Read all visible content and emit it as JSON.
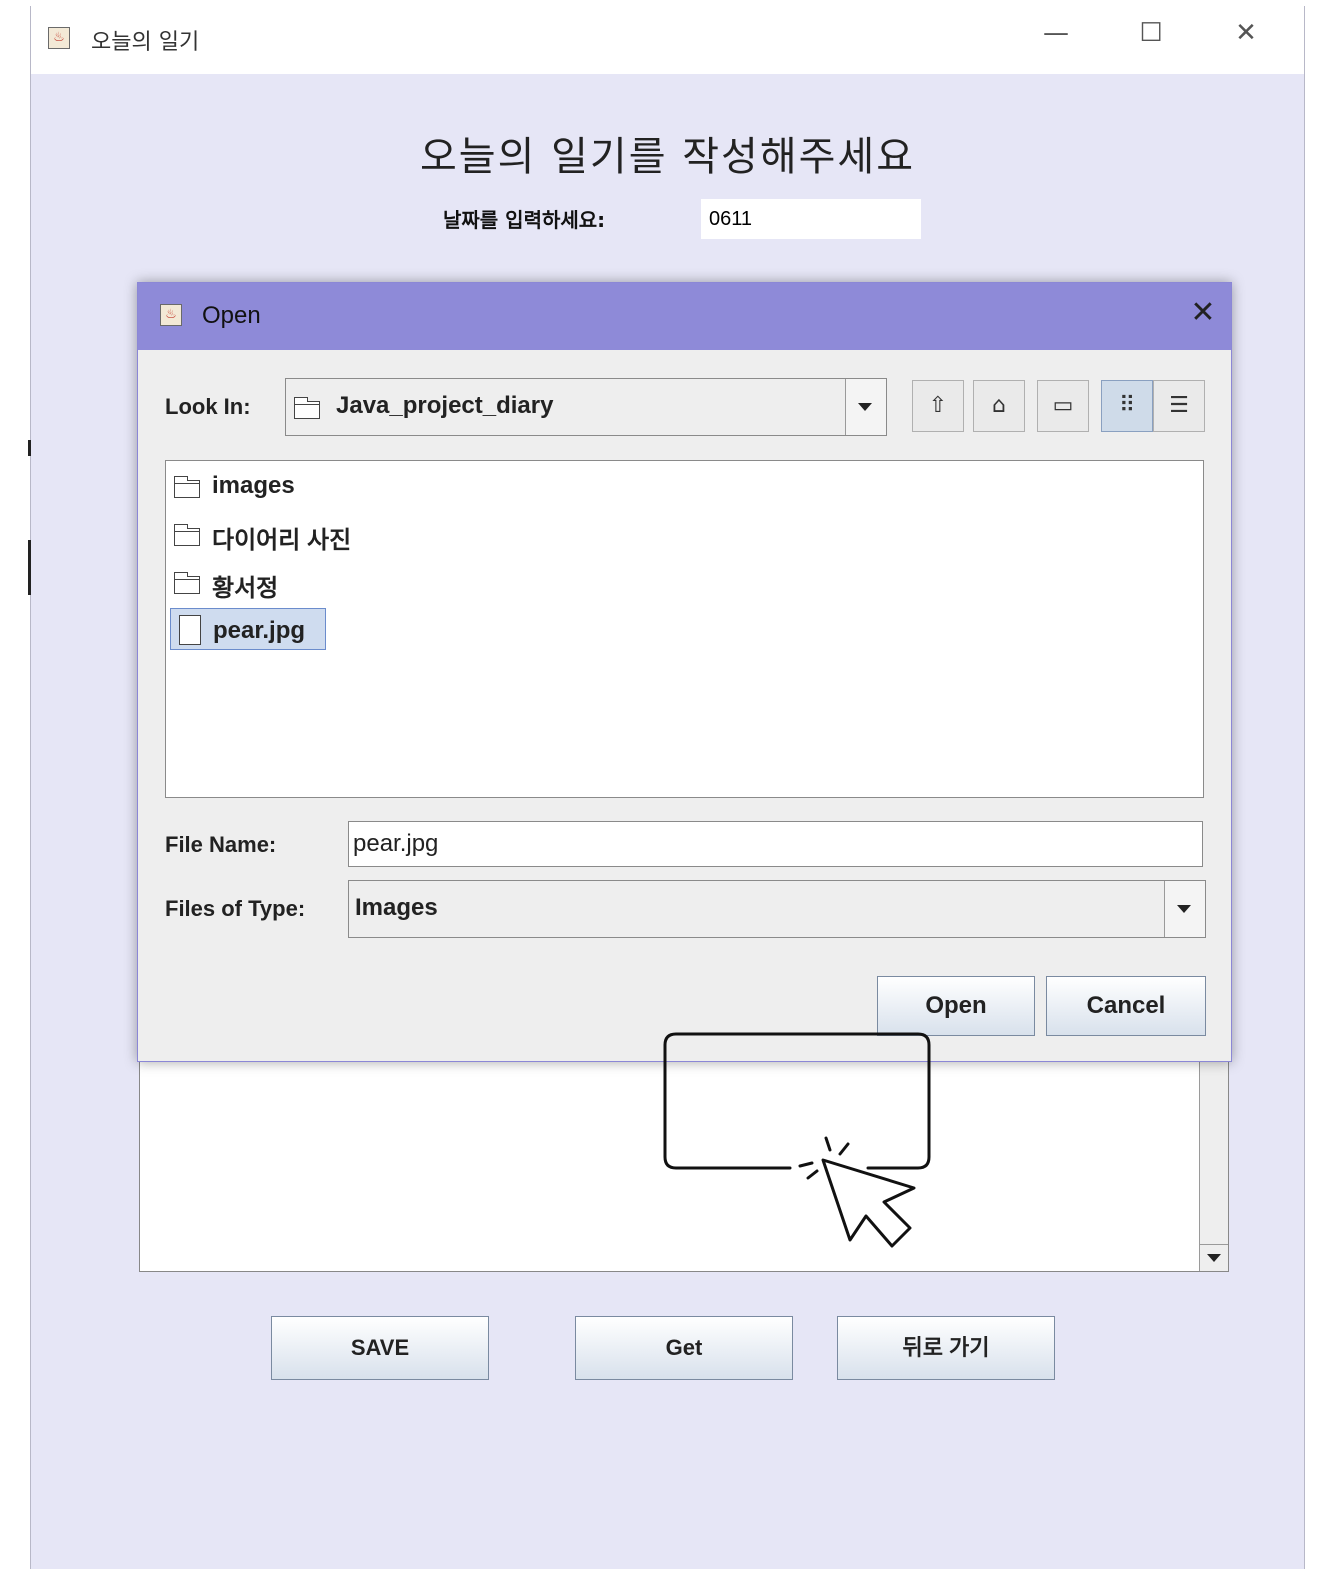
{
  "window": {
    "title": "오늘의 일기",
    "minimize": "—",
    "maximize": "☐",
    "close": "✕"
  },
  "form": {
    "heading": "오늘의 일기를 작성해주세요",
    "date_label": "날짜를 입력하세요:",
    "date_value": "0611"
  },
  "buttons": {
    "save": "SAVE",
    "get": "Get",
    "back": "뒤로 가기"
  },
  "dialog": {
    "title": "Open",
    "close": "✕",
    "look_in_label": "Look In:",
    "look_in_value": "Java_project_diary",
    "toolbar_icons": [
      "up-folder-icon",
      "home-icon",
      "new-folder-icon",
      "list-view-icon",
      "details-view-icon"
    ],
    "files": [
      {
        "name": "images",
        "type": "folder"
      },
      {
        "name": "다이어리 사진",
        "type": "folder"
      },
      {
        "name": "황서정",
        "type": "folder"
      },
      {
        "name": "pear.jpg",
        "type": "file",
        "selected": true
      }
    ],
    "file_name_label": "File Name:",
    "file_name_value": "pear.jpg",
    "files_of_type_label": "Files of Type:",
    "files_of_type_value": "Images",
    "open_button": "Open",
    "cancel_button": "Cancel"
  },
  "annotation": {
    "icon": "click-cursor-icon"
  }
}
